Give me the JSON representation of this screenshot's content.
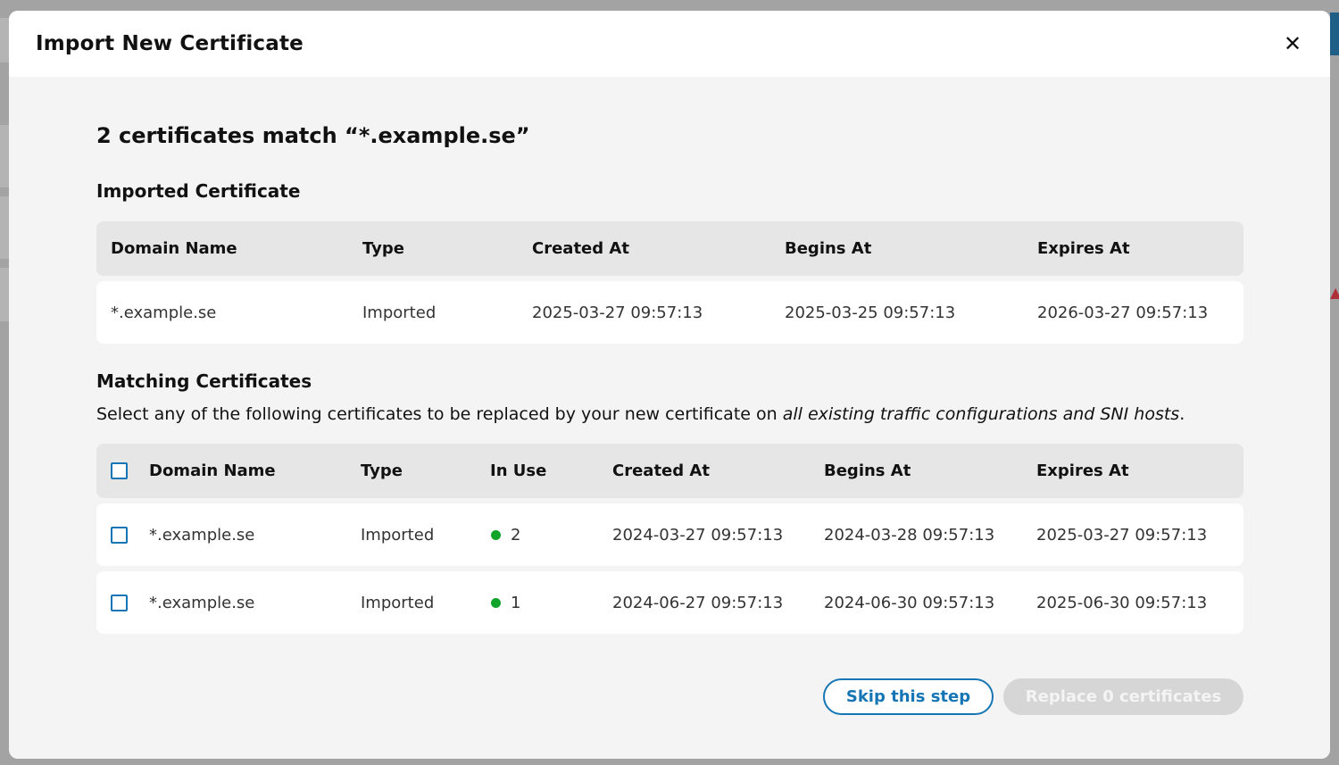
{
  "modal": {
    "title": "Import New Certificate",
    "close_icon": "close-icon"
  },
  "heading": "2 certificates match “*.example.se”",
  "imported": {
    "title": "Imported Certificate",
    "columns": [
      "Domain Name",
      "Type",
      "Created At",
      "Begins At",
      "Expires At"
    ],
    "row": {
      "domain": "*.example.se",
      "type": "Imported",
      "created": "2025-03-27 09:57:13",
      "begins": "2025-03-25 09:57:13",
      "expires": "2026-03-27 09:57:13"
    }
  },
  "matching": {
    "title": "Matching Certificates",
    "desc_prefix": "Select any of the following certificates to be replaced by your new certificate on ",
    "desc_emphasis": "all existing traffic configurations and SNI hosts",
    "desc_suffix": ".",
    "columns": [
      "Domain Name",
      "Type",
      "In Use",
      "Created At",
      "Begins At",
      "Expires At"
    ],
    "rows": [
      {
        "domain": "*.example.se",
        "type": "Imported",
        "in_use": "2",
        "created": "2024-03-27 09:57:13",
        "begins": "2024-03-28 09:57:13",
        "expires": "2025-03-27 09:57:13"
      },
      {
        "domain": "*.example.se",
        "type": "Imported",
        "in_use": "1",
        "created": "2024-06-27 09:57:13",
        "begins": "2024-06-30 09:57:13",
        "expires": "2025-06-30 09:57:13"
      }
    ]
  },
  "buttons": {
    "skip": "Skip this step",
    "replace": "Replace 0 certificates"
  },
  "colors": {
    "accent": "#1676b5",
    "in_use_dot": "#12a32a",
    "disabled_button": "#d6d6d6"
  }
}
